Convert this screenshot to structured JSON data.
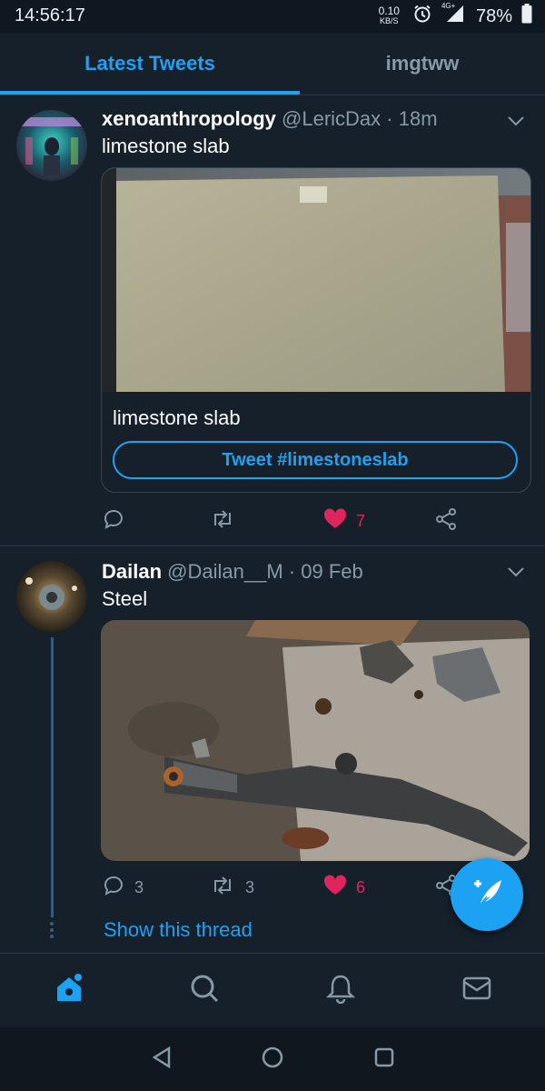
{
  "status_bar": {
    "time": "14:56:17",
    "net_speed_value": "0.10",
    "net_speed_unit": "KB/S",
    "network_type": "4G+",
    "battery": "78%"
  },
  "tabs": [
    {
      "label": "Latest Tweets",
      "active": true
    },
    {
      "label": "imgtww",
      "active": false
    }
  ],
  "tweets": [
    {
      "display_name": "xenoanthropology",
      "handle": "@LericDax",
      "separator": "·",
      "time": "18m",
      "text": "limestone slab",
      "card": {
        "image_label": "limestone slab photo",
        "title": "limestone slab",
        "button_label": "Tweet #limestoneslab"
      },
      "actions": {
        "replies": "",
        "retweets": "",
        "likes": "7",
        "liked": true
      }
    },
    {
      "display_name": "Dailan",
      "handle": "@Dailan__M",
      "separator": "·",
      "time": "09 Feb",
      "text": "Steel",
      "image_label": "steel car subframe photo",
      "actions": {
        "replies": "3",
        "retweets": "3",
        "likes": "6",
        "liked": true
      },
      "show_thread": "Show this thread"
    }
  ],
  "bottom_nav": [
    "home-icon",
    "search-icon",
    "notifications-icon",
    "messages-icon"
  ],
  "colors": {
    "background": "#15202b",
    "accent": "#1da1f2",
    "like": "#e0245e",
    "muted": "#8899a6"
  }
}
